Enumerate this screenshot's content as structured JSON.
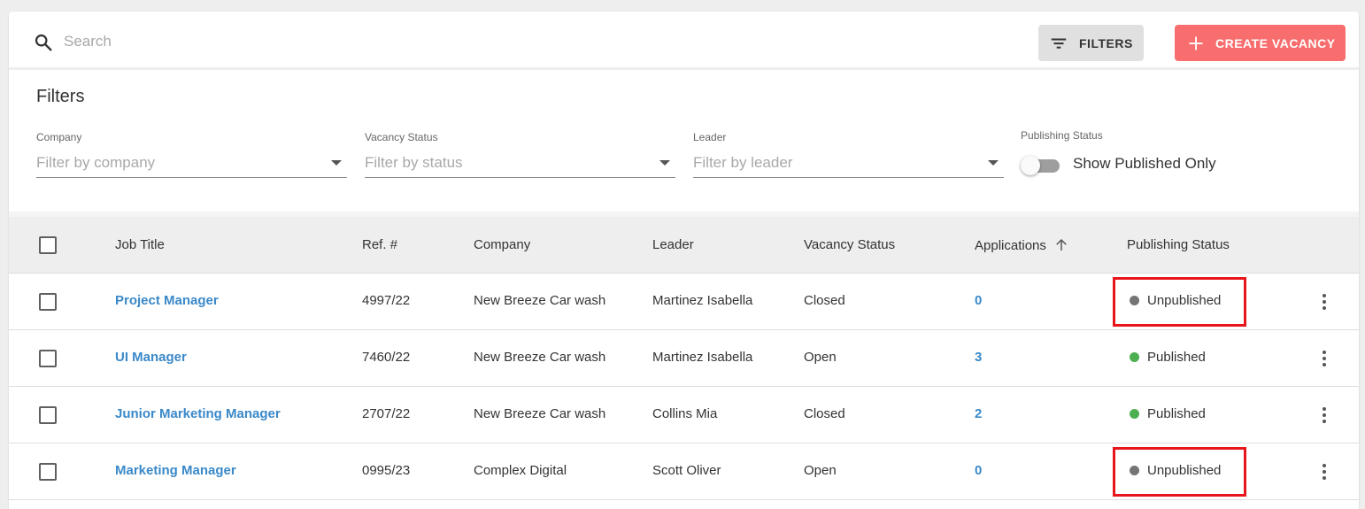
{
  "search": {
    "placeholder": "Search"
  },
  "toolbar": {
    "filters_label": "FILTERS",
    "create_label": "CREATE VACANCY",
    "create_color": "#f86d6d"
  },
  "filters": {
    "title": "Filters",
    "company": {
      "label": "Company",
      "placeholder": "Filter by company"
    },
    "vacancy_status": {
      "label": "Vacancy Status",
      "placeholder": "Filter by status"
    },
    "leader": {
      "label": "Leader",
      "placeholder": "Filter by leader"
    },
    "publishing": {
      "label": "Publishing Status",
      "toggle_label": "Show Published Only",
      "toggle_on": false
    }
  },
  "table": {
    "columns": [
      "Job Title",
      "Ref. #",
      "Company",
      "Leader",
      "Vacancy Status",
      "Applications",
      "Publishing Status"
    ],
    "sorted_column": "Applications",
    "sort_direction": "ascending",
    "rows": [
      {
        "title": "Project Manager",
        "ref": "4997/22",
        "company": "New Breeze Car wash",
        "leader": "Martinez Isabella",
        "vacancy_status": "Closed",
        "applications": "0",
        "publishing": "Unpublished",
        "dot_color": "#757575",
        "highlighted": true
      },
      {
        "title": "UI Manager",
        "ref": "7460/22",
        "company": "New Breeze Car wash",
        "leader": "Martinez Isabella",
        "vacancy_status": "Open",
        "applications": "3",
        "publishing": "Published",
        "dot_color": "#4caf50",
        "highlighted": false
      },
      {
        "title": "Junior Marketing Manager",
        "ref": "2707/22",
        "company": "New Breeze Car wash",
        "leader": "Collins Mia",
        "vacancy_status": "Closed",
        "applications": "2",
        "publishing": "Published",
        "dot_color": "#4caf50",
        "highlighted": false
      },
      {
        "title": "Marketing Manager",
        "ref": "0995/23",
        "company": "Complex Digital",
        "leader": "Scott Oliver",
        "vacancy_status": "Open",
        "applications": "0",
        "publishing": "Unpublished",
        "dot_color": "#757575",
        "highlighted": true
      }
    ]
  },
  "highlight_color": "#e8151b"
}
